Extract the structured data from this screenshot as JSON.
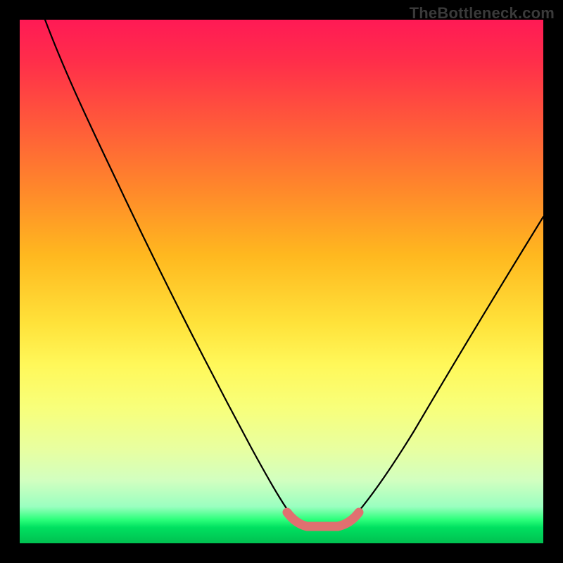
{
  "watermark": {
    "text": "TheBottleneck.com"
  },
  "colors": {
    "curve": "#000000",
    "accent": "#e07070",
    "frame": "#000000"
  },
  "chart_data": {
    "type": "line",
    "title": "",
    "xlabel": "",
    "ylabel": "",
    "xlim": [
      0,
      100
    ],
    "ylim": [
      0,
      100
    ],
    "series": [
      {
        "name": "left-branch",
        "x": [
          5,
          10,
          15,
          20,
          25,
          30,
          35,
          40,
          45,
          50,
          52
        ],
        "y": [
          100,
          90,
          78,
          66,
          55,
          44,
          34,
          24,
          15,
          7,
          4
        ]
      },
      {
        "name": "right-branch",
        "x": [
          62,
          65,
          70,
          75,
          80,
          85,
          90,
          95,
          100
        ],
        "y": [
          4,
          7,
          13,
          20,
          28,
          36,
          45,
          54,
          63
        ]
      },
      {
        "name": "flat-bottom-accent",
        "x": [
          50,
          52,
          54,
          56,
          58,
          60,
          62
        ],
        "y": [
          5,
          4,
          3.5,
          3.5,
          3.5,
          4,
          5
        ]
      }
    ],
    "annotations": []
  }
}
